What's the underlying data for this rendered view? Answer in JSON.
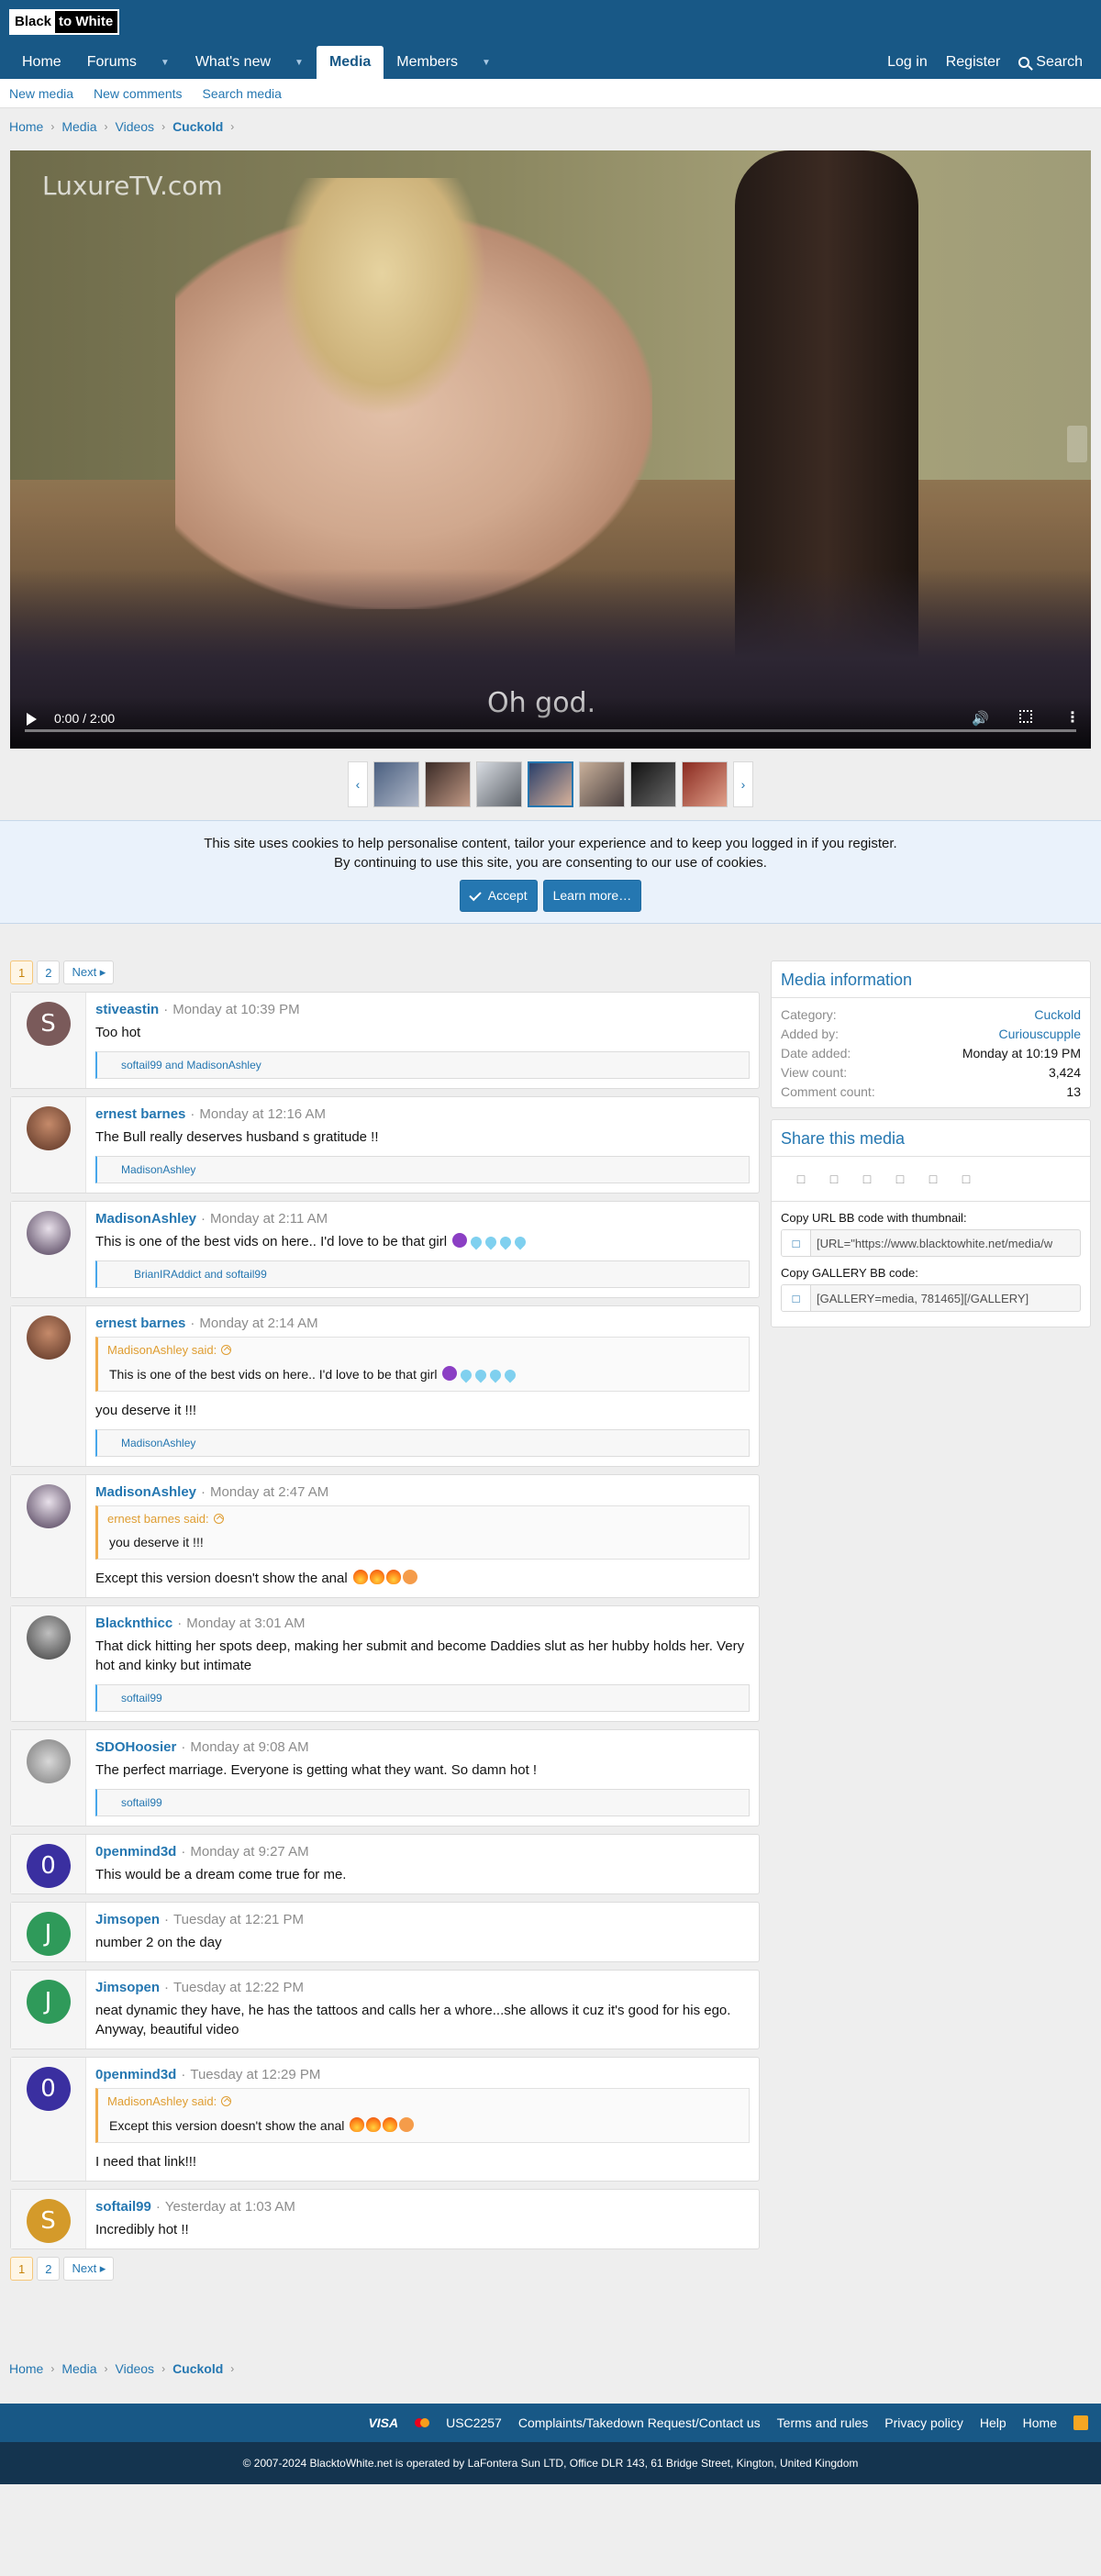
{
  "header": {
    "logo_left": "Black",
    "logo_right": "to White"
  },
  "nav": {
    "tabs": [
      {
        "label": "Home"
      },
      {
        "label": "Forums"
      },
      {
        "label": "What's new"
      },
      {
        "label": "Media"
      },
      {
        "label": "Members"
      }
    ],
    "login": "Log in",
    "register": "Register",
    "search": "Search"
  },
  "subnav": {
    "items": [
      "New media",
      "New comments",
      "Search media"
    ]
  },
  "breadcrumb": {
    "items": [
      "Home",
      "Media",
      "Videos"
    ],
    "current": "Cuckold"
  },
  "video": {
    "watermark": "LuxureTV.com",
    "caption": "Oh god.",
    "time": "0:00 / 2:00",
    "progress": 0
  },
  "cookie": {
    "line1": "This site uses cookies to help personalise content, tailor your experience and to keep you logged in if you register.",
    "line2": "By continuing to use this site, you are consenting to our use of cookies.",
    "accept": "Accept",
    "learn": "Learn more…"
  },
  "pager": {
    "p1": "1",
    "p2": "2",
    "next": "Next ▸"
  },
  "comments": [
    {
      "user": "stiveastin",
      "time": "Monday at 10:39 PM",
      "text": "Too hot",
      "reactions": "softail99 and MadisonAshley",
      "avatar_letter": "S",
      "avatar_color": "#7a5a5a"
    },
    {
      "user": "ernest barnes",
      "time": "Monday at 12:16 AM",
      "text": "The Bull really deserves husband s gratitude !!",
      "reactions": "MadisonAshley",
      "avatar_letter": "",
      "avatar_color": "#8a5a48"
    },
    {
      "user": "MadisonAshley",
      "time": "Monday at 2:11 AM",
      "text": "This is one of the best vids on here.. I'd love to be that girl",
      "reactions": "BrianIRAddict and softail99",
      "avatar_letter": "",
      "avatar_color": "#6e5870"
    },
    {
      "user": "ernest barnes",
      "time": "Monday at 2:14 AM",
      "quote_author": "MadisonAshley said:",
      "quote_text": "This is one of the best vids on here.. I'd love to be that girl",
      "text": "you deserve it !!!",
      "reactions": "MadisonAshley",
      "avatar_letter": "",
      "avatar_color": "#8a5a48"
    },
    {
      "user": "MadisonAshley",
      "time": "Monday at 2:47 AM",
      "quote_author": "ernest barnes said:",
      "quote_text": "you deserve it !!!",
      "text": "Except this version doesn't show the anal",
      "avatar_letter": "",
      "avatar_color": "#6e5870"
    },
    {
      "user": "Blacknthicc",
      "time": "Monday at 3:01 AM",
      "text": "That dick hitting her spots deep, making her submit and become Daddies slut as her hubby holds her. Very hot and kinky but intimate",
      "reactions": "softail99",
      "avatar_letter": "",
      "avatar_color": "#7d7d7d"
    },
    {
      "user": "SDOHoosier",
      "time": "Monday at 9:08 AM",
      "text": "The perfect marriage. Everyone is getting what they want. So damn hot !",
      "reactions": "softail99",
      "avatar_letter": "",
      "avatar_color": "#9a9a9a"
    },
    {
      "user": "0penmind3d",
      "time": "Monday at 9:27 AM",
      "text": "This would be a dream come true for me.",
      "avatar_letter": "0",
      "avatar_color": "#3a2fa0"
    },
    {
      "user": "Jimsopen",
      "time": "Tuesday at 12:21 PM",
      "text": "number 2 on the day",
      "avatar_letter": "J",
      "avatar_color": "#2f9a5a"
    },
    {
      "user": "Jimsopen",
      "time": "Tuesday at 12:22 PM",
      "text": "neat dynamic they have, he has the tattoos and calls her a whore...she allows it cuz it's good for his ego. Anyway, beautiful video",
      "avatar_letter": "J",
      "avatar_color": "#2f9a5a"
    },
    {
      "user": "0penmind3d",
      "time": "Tuesday at 12:29 PM",
      "quote_author": "MadisonAshley said:",
      "quote_text": "Except this version doesn't show the anal",
      "text": "I need that link!!!",
      "avatar_letter": "0",
      "avatar_color": "#3a2fa0"
    },
    {
      "user": "softail99",
      "time": "Yesterday at 1:03 AM",
      "text": "Incredibly hot !!",
      "avatar_letter": "S",
      "avatar_color": "#d49a2a"
    }
  ],
  "media_info": {
    "title": "Media information",
    "category_label": "Category:",
    "category": "Cuckold",
    "added_label": "Added by:",
    "added_by": "Curiouscupple",
    "date_label": "Date added:",
    "date": "Monday at 10:19 PM",
    "views_label": "View count:",
    "views": "3,424",
    "comments_label": "Comment count:",
    "comments": "13"
  },
  "share": {
    "title": "Share this media",
    "bb_thumb_label": "Copy URL BB code with thumbnail:",
    "bb_thumb_value": "[URL=\"https://www.blacktowhite.net/media/w",
    "bb_gallery_label": "Copy GALLERY BB code:",
    "bb_gallery_value": "[GALLERY=media, 781465][/GALLERY]"
  },
  "footer": {
    "visa": "VISA",
    "usc": "USC2257",
    "complaints": "Complaints/Takedown Request/Contact us",
    "terms": "Terms and rules",
    "privacy": "Privacy policy",
    "help": "Help",
    "home": "Home",
    "copyright": "© 2007-2024 BlacktoWhite.net is operated by LaFontera Sun LTD, Office DLR 143, 61 Bridge Street, Kington, United Kingdom"
  },
  "colors": {
    "header": "#185886",
    "link": "#2577b1",
    "accent_quote": "#f0ad4e"
  }
}
